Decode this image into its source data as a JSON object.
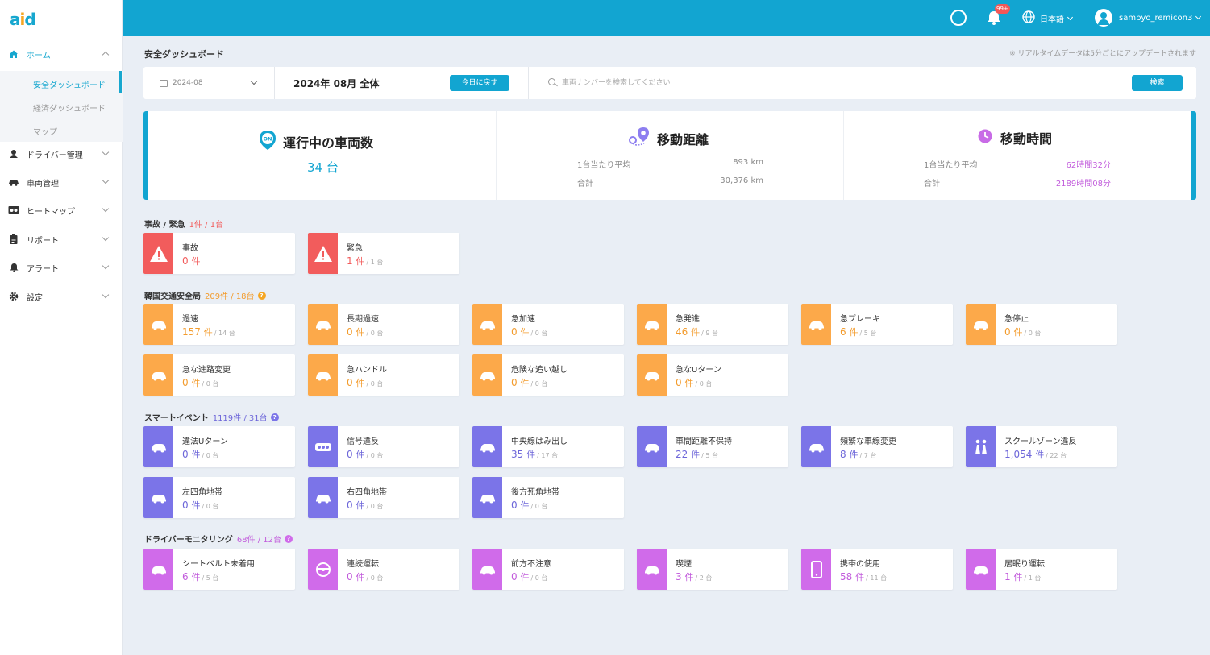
{
  "app": {
    "logo": "aid"
  },
  "sidebar": {
    "items": [
      {
        "label": "ホーム",
        "icon": "home-icon"
      },
      {
        "label": "ドライバー管理",
        "icon": "driver-icon"
      },
      {
        "label": "車両管理",
        "icon": "car-icon"
      },
      {
        "label": "ヒートマップ",
        "icon": "heatmap-icon"
      },
      {
        "label": "リポート",
        "icon": "report-icon"
      },
      {
        "label": "アラート",
        "icon": "bell-icon"
      },
      {
        "label": "設定",
        "icon": "gear-icon"
      }
    ],
    "sub_items": [
      "安全ダッシュボード",
      "経済ダッシュボード",
      "マップ"
    ]
  },
  "header": {
    "notification_badge": "99+",
    "language": "日本語",
    "username": "sampyo_remicon3"
  },
  "page": {
    "title": "安全ダッシュボード",
    "notice": "※ リアルタイムデータは5分ごとにアップデートされます"
  },
  "filter": {
    "date": "2024-08",
    "period": "2024年 08月 全体",
    "today_button": "今日に戻す",
    "search_placeholder": "車両ナンバーを検索してください",
    "search_button": "検索"
  },
  "summary": {
    "vehicles": {
      "icon_text": "ON",
      "title": "運行中の車両数",
      "value": "34 台"
    },
    "distance": {
      "title": "移動距離",
      "avg_label": "1台当たり平均",
      "avg_value": "893 km",
      "total_label": "合計",
      "total_value": "30,376 km"
    },
    "time": {
      "title": "移動時間",
      "avg_label": "1台当たり平均",
      "avg_value": "62時間32分",
      "total_label": "合計",
      "total_value": "2189時間08分"
    }
  },
  "sections": {
    "accident": {
      "title": "事故 / 緊急",
      "count": "1件 / 1台"
    },
    "korea": {
      "title": "韓国交通安全局",
      "count": "209件 / 18台"
    },
    "smart": {
      "title": "スマートイベント",
      "count": "1119件 / 31台"
    },
    "driver": {
      "title": "ドライバーモニタリング",
      "count": "68件 / 12台"
    }
  },
  "cards": {
    "accident": [
      {
        "name": "事故",
        "count": "0",
        "unit": "件",
        "sub": ""
      },
      {
        "name": "緊急",
        "count": "1",
        "unit": "件",
        "sub": "/ 1 台"
      }
    ],
    "korea": [
      {
        "name": "過速",
        "count": "157",
        "unit": "件",
        "sub": "/ 14 台"
      },
      {
        "name": "長期過速",
        "count": "0",
        "unit": "件",
        "sub": "/ 0 台"
      },
      {
        "name": "急加速",
        "count": "0",
        "unit": "件",
        "sub": "/ 0 台"
      },
      {
        "name": "急発進",
        "count": "46",
        "unit": "件",
        "sub": "/ 9 台"
      },
      {
        "name": "急ブレーキ",
        "count": "6",
        "unit": "件",
        "sub": "/ 5 台"
      },
      {
        "name": "急停止",
        "count": "0",
        "unit": "件",
        "sub": "/ 0 台"
      },
      {
        "name": "急な進路変更",
        "count": "0",
        "unit": "件",
        "sub": "/ 0 台"
      },
      {
        "name": "急ハンドル",
        "count": "0",
        "unit": "件",
        "sub": "/ 0 台"
      },
      {
        "name": "危険な追い越し",
        "count": "0",
        "unit": "件",
        "sub": "/ 0 台"
      },
      {
        "name": "急なUターン",
        "count": "0",
        "unit": "件",
        "sub": "/ 0 台"
      }
    ],
    "smart": [
      {
        "name": "違法Uターン",
        "count": "0",
        "unit": "件",
        "sub": "/ 0 台"
      },
      {
        "name": "信号違反",
        "count": "0",
        "unit": "件",
        "sub": "/ 0 台"
      },
      {
        "name": "中央線はみ出し",
        "count": "35",
        "unit": "件",
        "sub": "/ 17 台"
      },
      {
        "name": "車間距離不保持",
        "count": "22",
        "unit": "件",
        "sub": "/ 5 台"
      },
      {
        "name": "頻繁な車線変更",
        "count": "8",
        "unit": "件",
        "sub": "/ 7 台"
      },
      {
        "name": "スクールゾーン違反",
        "count": "1,054",
        "unit": "件",
        "sub": "/ 22 台"
      },
      {
        "name": "左四角地帯",
        "count": "0",
        "unit": "件",
        "sub": "/ 0 台"
      },
      {
        "name": "右四角地帯",
        "count": "0",
        "unit": "件",
        "sub": "/ 0 台"
      },
      {
        "name": "後方死角地帯",
        "count": "0",
        "unit": "件",
        "sub": "/ 0 台"
      }
    ],
    "driver": [
      {
        "name": "シートベルト未着用",
        "count": "6",
        "unit": "件",
        "sub": "/ 5 台"
      },
      {
        "name": "連続運転",
        "count": "0",
        "unit": "件",
        "sub": "/ 0 台"
      },
      {
        "name": "前方不注意",
        "count": "0",
        "unit": "件",
        "sub": "/ 0 台"
      },
      {
        "name": "喫煙",
        "count": "3",
        "unit": "件",
        "sub": "/ 2 台"
      },
      {
        "name": "携帯の使用",
        "count": "58",
        "unit": "件",
        "sub": "/ 11 台"
      },
      {
        "name": "居眠り運転",
        "count": "1",
        "unit": "件",
        "sub": "/ 1 台"
      }
    ]
  },
  "colors": {
    "accent": "#12a5d1",
    "accident": "#f25c5c",
    "korea": "#fca94a",
    "smart": "#7b74e8",
    "driver": "#d06bea"
  }
}
